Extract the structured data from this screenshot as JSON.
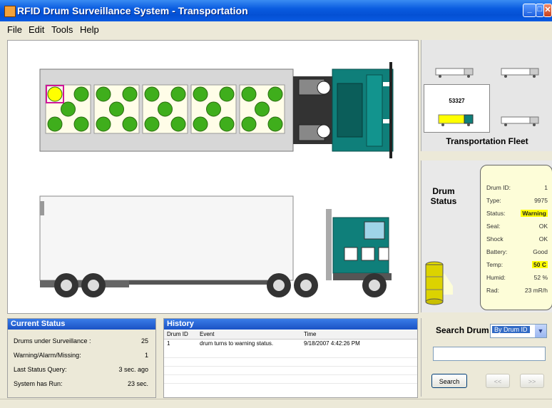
{
  "window": {
    "title": "RFID Drum Surveillance System - Transportation"
  },
  "menu": [
    "File",
    "Edit",
    "Tools",
    "Help"
  ],
  "fleet": {
    "title": "Transportation Fleet",
    "selected_id": "53327"
  },
  "drum_status": {
    "heading": "Drum Status",
    "fields": [
      {
        "label": "Drum ID:",
        "value": "1",
        "highlight": false
      },
      {
        "label": "Type:",
        "value": "9975",
        "highlight": false
      },
      {
        "label": "Status:",
        "value": "Warning",
        "highlight": true
      },
      {
        "label": "Seal:",
        "value": "OK",
        "highlight": false
      },
      {
        "label": "Shock",
        "value": "OK",
        "highlight": false
      },
      {
        "label": "Battery:",
        "value": "Good",
        "highlight": false
      },
      {
        "label": "Temp:",
        "value": "50 C",
        "highlight": true
      },
      {
        "label": "Humid:",
        "value": "52 %",
        "highlight": false
      },
      {
        "label": "Rad:",
        "value": "23 mR/h",
        "highlight": false
      }
    ]
  },
  "current_status": {
    "title": "Current Status",
    "rows": [
      {
        "label": "Drums under Surveillance :",
        "value": "25"
      },
      {
        "label": "Warning/Alarm/Missing:",
        "value": "1"
      },
      {
        "label": "Last Status Query:",
        "value": "3 sec. ago"
      },
      {
        "label": "System has Run:",
        "value": "23 sec."
      }
    ]
  },
  "history": {
    "title": "History",
    "columns": [
      "Drum ID",
      "Event",
      "Time"
    ],
    "rows": [
      {
        "drum_id": "1",
        "event": "drum turns to warning status.",
        "time": "9/18/2007 4:42:26 PM"
      }
    ]
  },
  "search": {
    "label": "Search Drum",
    "mode": "By Drum ID",
    "query": "",
    "search_label": "Search",
    "prev_label": "<<",
    "next_label": ">>"
  },
  "colors": {
    "drum_ok": "#3fae1c",
    "drum_warning": "#ffff00",
    "cab": "#0f7f7a",
    "title_bar": "#0a5ce0"
  }
}
